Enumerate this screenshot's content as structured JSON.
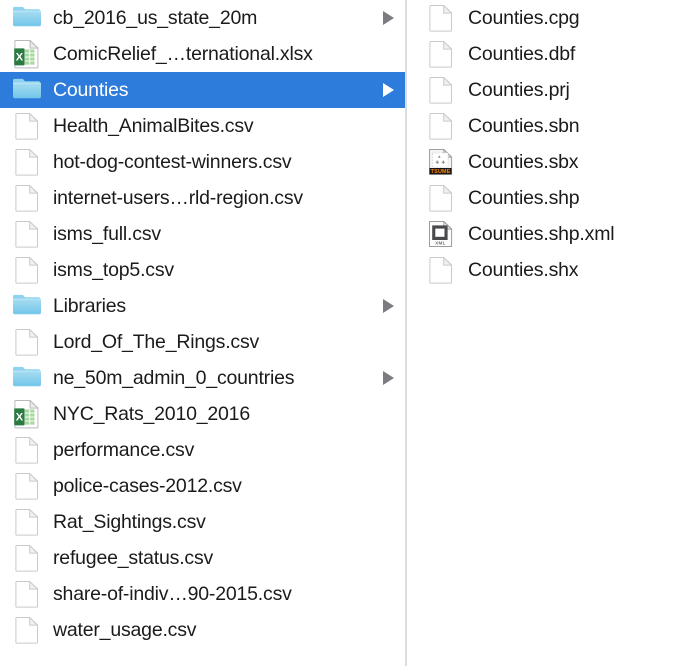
{
  "window": {
    "title": "Finder — Column View",
    "view_mode": "column",
    "selection_color": "#2d7cdb",
    "folder_color": "#7ecbec",
    "divider_color": "#dcdde0",
    "text_color": "#1b1b1b",
    "selected_text_color": "#ffffff"
  },
  "columns": [
    {
      "name": "parent-column",
      "items": [
        {
          "label": "cb_2016_us_state_20m",
          "icon": "folder-icon",
          "kind": "folder",
          "selected": false,
          "has_disclosure": true
        },
        {
          "label": "ComicRelief_…ternational.xlsx",
          "icon": "excel-icon",
          "kind": "xlsx",
          "selected": false,
          "has_disclosure": false
        },
        {
          "label": "Counties",
          "icon": "folder-icon",
          "kind": "folder",
          "selected": true,
          "has_disclosure": true
        },
        {
          "label": "Health_AnimalBites.csv",
          "icon": "blank-document-icon",
          "kind": "csv",
          "selected": false,
          "has_disclosure": false
        },
        {
          "label": "hot-dog-contest-winners.csv",
          "icon": "blank-document-icon",
          "kind": "csv",
          "selected": false,
          "has_disclosure": false
        },
        {
          "label": "internet-users…rld-region.csv",
          "icon": "blank-document-icon",
          "kind": "csv",
          "selected": false,
          "has_disclosure": false
        },
        {
          "label": "isms_full.csv",
          "icon": "blank-document-icon",
          "kind": "csv",
          "selected": false,
          "has_disclosure": false
        },
        {
          "label": "isms_top5.csv",
          "icon": "blank-document-icon",
          "kind": "csv",
          "selected": false,
          "has_disclosure": false
        },
        {
          "label": "Libraries",
          "icon": "folder-icon",
          "kind": "folder",
          "selected": false,
          "has_disclosure": true
        },
        {
          "label": "Lord_Of_The_Rings.csv",
          "icon": "blank-document-icon",
          "kind": "csv",
          "selected": false,
          "has_disclosure": false
        },
        {
          "label": "ne_50m_admin_0_countries",
          "icon": "folder-icon",
          "kind": "folder",
          "selected": false,
          "has_disclosure": true
        },
        {
          "label": "NYC_Rats_2010_2016",
          "icon": "excel-icon",
          "kind": "xlsx",
          "selected": false,
          "has_disclosure": false
        },
        {
          "label": "performance.csv",
          "icon": "blank-document-icon",
          "kind": "csv",
          "selected": false,
          "has_disclosure": false
        },
        {
          "label": "police-cases-2012.csv",
          "icon": "blank-document-icon",
          "kind": "csv",
          "selected": false,
          "has_disclosure": false
        },
        {
          "label": "Rat_Sightings.csv",
          "icon": "blank-document-icon",
          "kind": "csv",
          "selected": false,
          "has_disclosure": false
        },
        {
          "label": "refugee_status.csv",
          "icon": "blank-document-icon",
          "kind": "csv",
          "selected": false,
          "has_disclosure": false
        },
        {
          "label": "share-of-indiv…90-2015.csv",
          "icon": "blank-document-icon",
          "kind": "csv",
          "selected": false,
          "has_disclosure": false
        },
        {
          "label": "water_usage.csv",
          "icon": "blank-document-icon",
          "kind": "csv",
          "selected": false,
          "has_disclosure": false
        }
      ]
    },
    {
      "name": "counties-column",
      "items": [
        {
          "label": "Counties.cpg",
          "icon": "blank-document-icon",
          "kind": "cpg",
          "selected": false,
          "has_disclosure": false
        },
        {
          "label": "Counties.dbf",
          "icon": "blank-document-icon",
          "kind": "dbf",
          "selected": false,
          "has_disclosure": false
        },
        {
          "label": "Counties.prj",
          "icon": "blank-document-icon",
          "kind": "prj",
          "selected": false,
          "has_disclosure": false
        },
        {
          "label": "Counties.sbn",
          "icon": "blank-document-icon",
          "kind": "sbn",
          "selected": false,
          "has_disclosure": false
        },
        {
          "label": "Counties.sbx",
          "icon": "tsume-document-icon",
          "kind": "sbx",
          "selected": false,
          "has_disclosure": false,
          "badge": "TSUME"
        },
        {
          "label": "Counties.shp",
          "icon": "blank-document-icon",
          "kind": "shp",
          "selected": false,
          "has_disclosure": false
        },
        {
          "label": "Counties.shp.xml",
          "icon": "xml-document-icon",
          "kind": "xml",
          "selected": false,
          "has_disclosure": false,
          "badge": "XML"
        },
        {
          "label": "Counties.shx",
          "icon": "blank-document-icon",
          "kind": "shx",
          "selected": false,
          "has_disclosure": false
        }
      ]
    }
  ]
}
